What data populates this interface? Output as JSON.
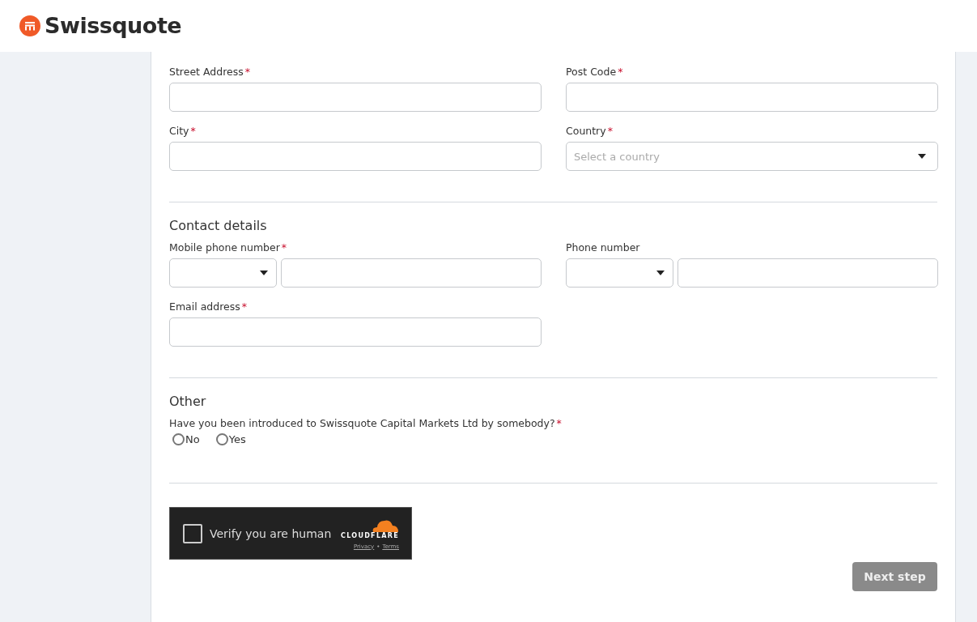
{
  "header": {
    "logo_text": "Swissquote"
  },
  "address_section": {
    "fields": [
      {
        "label": "Street Address",
        "required_mark": "*",
        "kind": "text"
      },
      {
        "label": "Post Code",
        "required_mark": "*",
        "kind": "text"
      },
      {
        "label": "City",
        "required_mark": "*",
        "kind": "text"
      },
      {
        "label": "Country",
        "required_mark": "*",
        "kind": "select",
        "placeholder": "Select a country"
      }
    ]
  },
  "contact_section": {
    "title": "Contact details",
    "fields": [
      {
        "label": "Mobile phone number",
        "required_mark": "*",
        "kind": "phone"
      },
      {
        "label": "Phone number",
        "kind": "phone"
      },
      {
        "label": "Email address",
        "required_mark": "*",
        "kind": "text"
      }
    ]
  },
  "other_section": {
    "title": "Other",
    "question": "Have you been introduced to Swissquote Capital Markets Ltd by somebody?",
    "required_mark": "*",
    "options": [
      {
        "label": "No",
        "selected": false
      },
      {
        "label": "Yes",
        "selected": false
      }
    ]
  },
  "captcha": {
    "label": "Verify you are human",
    "checked": false,
    "brand": "CLOUDFLARE",
    "links": [
      "Privacy",
      "Terms"
    ],
    "separator": "•"
  },
  "next_button": {
    "label": "Next step",
    "disabled": true
  }
}
